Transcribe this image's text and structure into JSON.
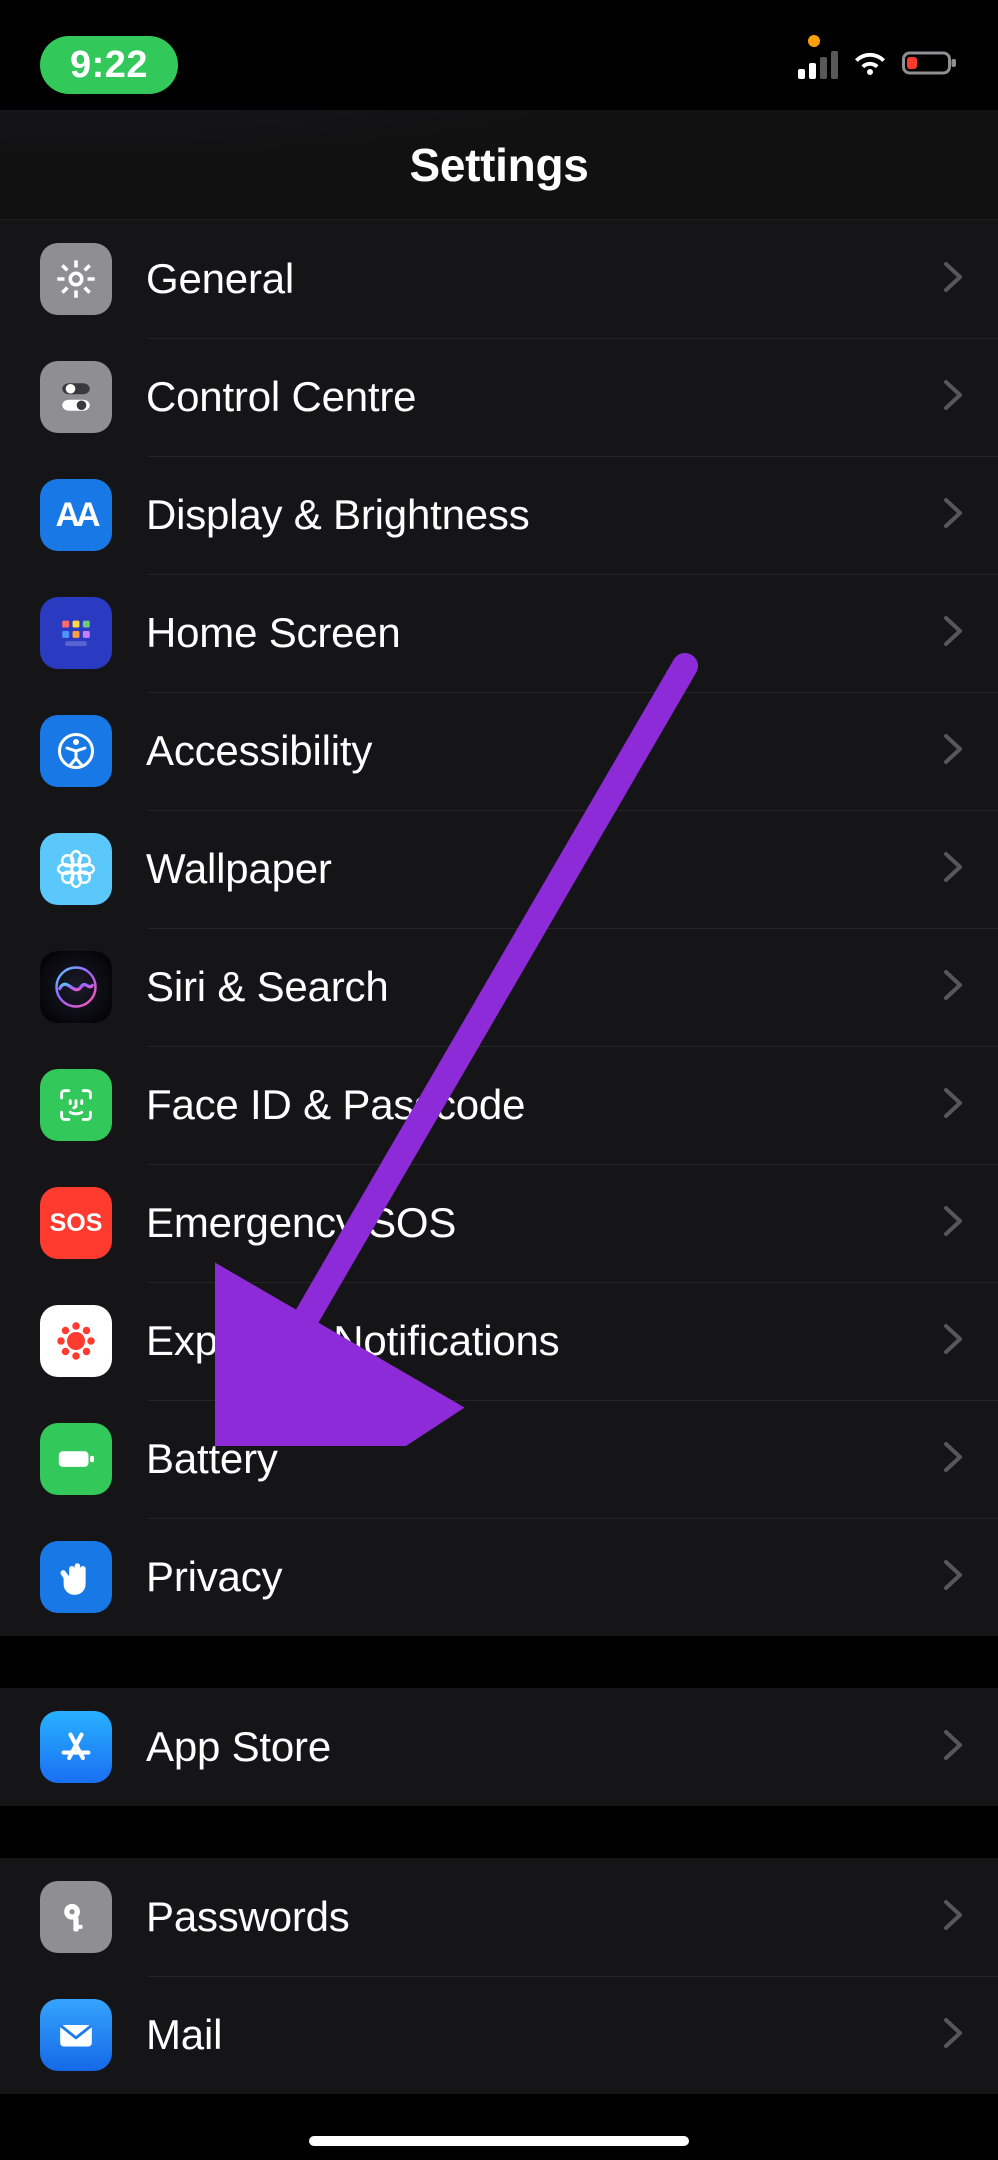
{
  "status": {
    "time": "9:22",
    "cell_bars_on": 2,
    "cell_bars_total": 4
  },
  "header": {
    "title": "Settings"
  },
  "group1": {
    "items": [
      {
        "label": "General"
      },
      {
        "label": "Control Centre"
      },
      {
        "label": "Display & Brightness"
      },
      {
        "label": "Home Screen"
      },
      {
        "label": "Accessibility"
      },
      {
        "label": "Wallpaper"
      },
      {
        "label": "Siri & Search"
      },
      {
        "label": "Face ID & Passcode"
      },
      {
        "label": "Emergency SOS"
      },
      {
        "label": "Exposure Notifications"
      },
      {
        "label": "Battery"
      },
      {
        "label": "Privacy"
      }
    ]
  },
  "group2": {
    "items": [
      {
        "label": "App Store"
      }
    ]
  },
  "group3": {
    "items": [
      {
        "label": "Passwords"
      },
      {
        "label": "Mail"
      }
    ]
  },
  "icons": {
    "general": "gear-icon",
    "control_centre": "switches-icon",
    "display_brightness": "aa-icon",
    "home_screen": "grid-icon",
    "accessibility": "accessibility-icon",
    "wallpaper": "flower-icon",
    "siri_search": "siri-icon",
    "face_id": "face-id-icon",
    "emergency_sos": "sos-icon",
    "exposure_notifications": "exposure-icon",
    "battery": "battery-icon",
    "privacy": "hand-icon",
    "app_store": "appstore-icon",
    "passwords": "key-icon",
    "mail": "mail-icon"
  },
  "colors": {
    "grey": "#8e8e93",
    "blue": "#1878e6",
    "light_blue": "#5ac8fa",
    "teal": "#63b3d1",
    "green": "#32c85a",
    "red": "#ff3b30",
    "white": "#ffffff",
    "key_grey": "#8e8e93",
    "mail_blue": "#1c7cf0"
  },
  "annotation": {
    "color": "#8e2bd9"
  },
  "display_brightness_text": "AA",
  "sos_text": "SOS"
}
